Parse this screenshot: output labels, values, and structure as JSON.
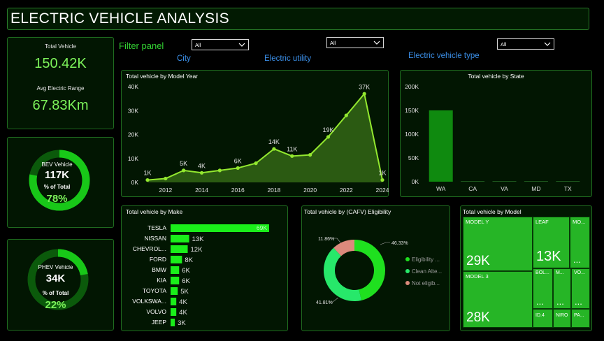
{
  "title": "ELECTRIC VEHICLE ANALYSIS",
  "kpi": {
    "total_label": "Total Vehicle",
    "total_value": "150.42K",
    "range_label": "Avg Electric Range",
    "range_value": "67.83Km"
  },
  "bev": {
    "label": "BEV Vehicle",
    "value": "117K",
    "pct_label": "% of Total",
    "pct": "78%",
    "fraction": 0.78
  },
  "phev": {
    "label": "PHEV Vehicle",
    "value": "34K",
    "pct_label": "% of Total",
    "pct": "22%",
    "fraction": 0.22
  },
  "filters": {
    "panel_label": "Filter panel",
    "city_label": "City",
    "city_value": "All",
    "utility_label": "Electric utility",
    "utility_value": "All",
    "type_label": "Electric vehicle type",
    "type_value": "All"
  },
  "colors": {
    "accent": "#7cf25a",
    "bar": "#1aee1a",
    "line": "#93e82f",
    "area": "#2b5a12",
    "blue": "#3b8fe8"
  },
  "chart_data": [
    {
      "type": "area",
      "title": "Total vehicle by Model Year",
      "x": [
        2011,
        2012,
        2013,
        2014,
        2015,
        2016,
        2017,
        2018,
        2019,
        2020,
        2021,
        2022,
        2023,
        2024
      ],
      "values": [
        1,
        1.6,
        5,
        4,
        5,
        6,
        8,
        14,
        11,
        11.5,
        19,
        28,
        37,
        1
      ],
      "labels": [
        {
          "x": 2011,
          "text": "1K"
        },
        {
          "x": 2013,
          "text": "5K"
        },
        {
          "x": 2014,
          "text": "4K"
        },
        {
          "x": 2016,
          "text": "6K"
        },
        {
          "x": 2018,
          "text": "14K"
        },
        {
          "x": 2019,
          "text": "11K"
        },
        {
          "x": 2021,
          "text": "19K"
        },
        {
          "x": 2023,
          "text": "37K"
        },
        {
          "x": 2024,
          "text": "1K"
        }
      ],
      "x_ticks": [
        "2012",
        "2014",
        "2016",
        "2018",
        "2020",
        "2022",
        "2024"
      ],
      "y_ticks": [
        "0K",
        "10K",
        "20K",
        "30K",
        "40K"
      ],
      "ylim": [
        0,
        40
      ]
    },
    {
      "type": "bar",
      "title": "Total vehicle by State",
      "categories": [
        "WA",
        "CA",
        "VA",
        "MD",
        "TX"
      ],
      "values": [
        150.1,
        0.1,
        0.05,
        0.03,
        0.03
      ],
      "y_ticks": [
        "0K",
        "50K",
        "100K",
        "150K",
        "200K"
      ],
      "ylim": [
        0,
        200
      ]
    },
    {
      "type": "bar",
      "title": "Total vehicle by Make",
      "categories": [
        "TESLA",
        "NISSAN",
        "CHEVROL...",
        "FORD",
        "BMW",
        "KIA",
        "TOYOTA",
        "VOLKSWA...",
        "VOLVO",
        "JEEP"
      ],
      "values": [
        69,
        13,
        12,
        8,
        6,
        6,
        5,
        4,
        4,
        3
      ],
      "labels": [
        "69K",
        "13K",
        "12K",
        "8K",
        "6K",
        "6K",
        "5K",
        "4K",
        "4K",
        "3K"
      ]
    },
    {
      "type": "pie",
      "title": "Total vehicle by (CAFV) Eligibility",
      "series": [
        {
          "name": "Eligibility ...",
          "value": 46.33,
          "color": "#1fe01f"
        },
        {
          "name": "Clean Alte...",
          "value": 41.81,
          "color": "#27e86a"
        },
        {
          "name": "Not eligib...",
          "value": 11.86,
          "color": "#dc8a7c"
        }
      ],
      "labels": [
        "46.33%",
        "41.81%",
        "11.86%"
      ]
    },
    {
      "type": "table",
      "title": "Total vehicle by Model",
      "cells": [
        {
          "name": "MODEL Y",
          "value": "29K"
        },
        {
          "name": "MODEL 3",
          "value": "28K"
        },
        {
          "name": "LEAF",
          "value": "13K"
        },
        {
          "name": "MO...",
          "value": "..."
        },
        {
          "name": "BOL...",
          "value": "..."
        },
        {
          "name": "M...",
          "value": "..."
        },
        {
          "name": "VO...",
          "value": "..."
        },
        {
          "name": "ID.4",
          "value": ""
        },
        {
          "name": "NIRO",
          "value": ""
        },
        {
          "name": "PA...",
          "value": ""
        }
      ]
    }
  ]
}
